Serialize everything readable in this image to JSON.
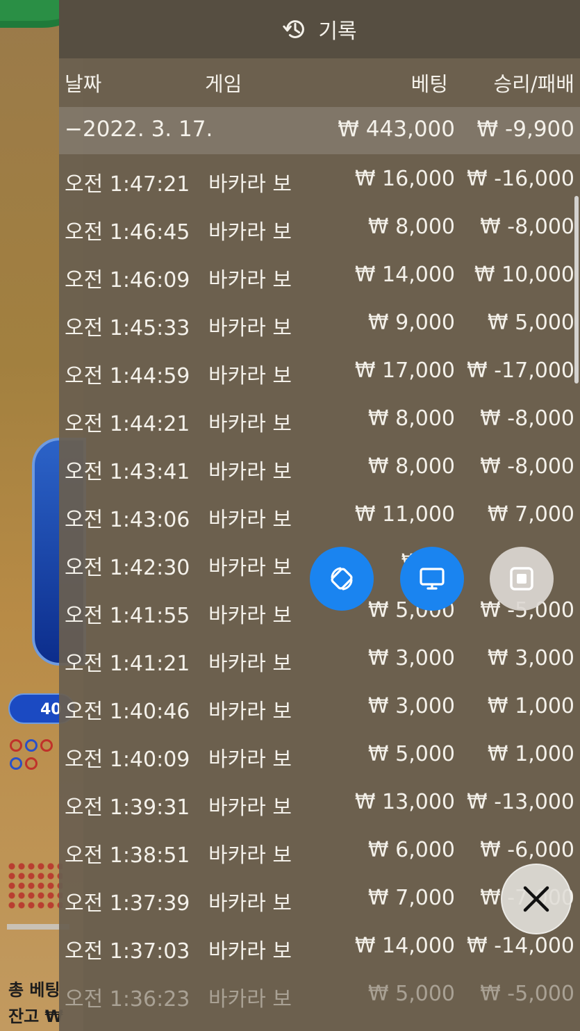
{
  "background": {
    "pill_text": "40",
    "bottom_texts": [
      "총 베팅",
      "잔고 ₩"
    ]
  },
  "header": {
    "title": "기록",
    "icon": "history-icon"
  },
  "columns": {
    "date": "날짜",
    "game": "게임",
    "bet": "베팅",
    "win_loss": "승리/패배"
  },
  "summary": {
    "date": "−2022. 3. 17.",
    "bet": "₩ 443,000",
    "win_loss": "₩ -9,900"
  },
  "rows": [
    {
      "time": "오전 1:47:21",
      "game": "바카라 보",
      "bet": "₩ 16,000",
      "win_loss": "₩ -16,000"
    },
    {
      "time": "오전 1:46:45",
      "game": "바카라 보",
      "bet": "₩ 8,000",
      "win_loss": "₩ -8,000"
    },
    {
      "time": "오전 1:46:09",
      "game": "바카라 보",
      "bet": "₩ 14,000",
      "win_loss": "₩ 10,000"
    },
    {
      "time": "오전 1:45:33",
      "game": "바카라 보",
      "bet": "₩ 9,000",
      "win_loss": "₩ 5,000"
    },
    {
      "time": "오전 1:44:59",
      "game": "바카라 보",
      "bet": "₩ 17,000",
      "win_loss": "₩ -17,000"
    },
    {
      "time": "오전 1:44:21",
      "game": "바카라 보",
      "bet": "₩ 8,000",
      "win_loss": "₩ -8,000"
    },
    {
      "time": "오전 1:43:41",
      "game": "바카라 보",
      "bet": "₩ 8,000",
      "win_loss": "₩ -8,000"
    },
    {
      "time": "오전 1:43:06",
      "game": "바카라 보",
      "bet": "₩ 11,000",
      "win_loss": "₩ 7,000"
    },
    {
      "time": "오전 1:42:30",
      "game": "바카라 보",
      "bet": "₩ 12",
      "win_loss": ""
    },
    {
      "time": "오전 1:41:55",
      "game": "바카라 보",
      "bet": "₩ 5,000",
      "win_loss": "₩ -5,000"
    },
    {
      "time": "오전 1:41:21",
      "game": "바카라 보",
      "bet": "₩ 3,000",
      "win_loss": "₩ 3,000"
    },
    {
      "time": "오전 1:40:46",
      "game": "바카라 보",
      "bet": "₩ 3,000",
      "win_loss": "₩ 1,000"
    },
    {
      "time": "오전 1:40:09",
      "game": "바카라 보",
      "bet": "₩ 5,000",
      "win_loss": "₩ 1,000"
    },
    {
      "time": "오전 1:39:31",
      "game": "바카라 보",
      "bet": "₩ 13,000",
      "win_loss": "₩ -13,000"
    },
    {
      "time": "오전 1:38:51",
      "game": "바카라 보",
      "bet": "₩ 6,000",
      "win_loss": "₩ -6,000"
    },
    {
      "time": "오전 1:37:39",
      "game": "바카라 보",
      "bet": "₩ 7,000",
      "win_loss": "₩ -7,000"
    },
    {
      "time": "오전 1:37:03",
      "game": "바카라 보",
      "bet": "₩ 14,000",
      "win_loss": "₩ -14,000"
    },
    {
      "time": "오전 1:36:23",
      "game": "바카라 보",
      "bet": "₩ 5,000",
      "win_loss": "₩ -5,000"
    }
  ],
  "floating_buttons": [
    {
      "name": "rotate-screen-button",
      "icon": "rotate-icon",
      "color": "#1a84f0"
    },
    {
      "name": "monitor-button",
      "icon": "monitor-icon",
      "color": "#1a84f0"
    },
    {
      "name": "stop-button",
      "icon": "stop-icon",
      "color": "#dcd8d2"
    }
  ],
  "close_button": {
    "icon": "close-icon"
  }
}
